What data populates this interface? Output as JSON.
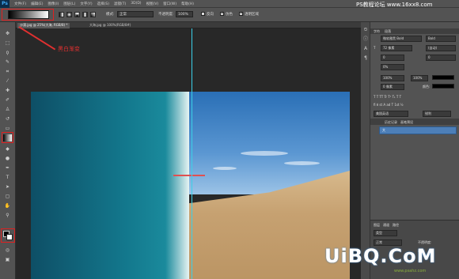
{
  "app": {
    "logo": "Ps"
  },
  "menu": [
    "文件(F)",
    "编辑(E)",
    "图像(I)",
    "图层(L)",
    "文字(Y)",
    "选择(S)",
    "滤镜(T)",
    "3D(D)",
    "视图(V)",
    "窗口(W)",
    "帮助(H)"
  ],
  "site_top": "PS教程论坛 www.16xx8.com",
  "options": {
    "mode_label": "模式:",
    "mode_value": "正常",
    "opacity_label": "不透明度:",
    "opacity_value": "100%",
    "reverse_label": "反向",
    "dither_label": "仿色",
    "transparency_label": "透明区域"
  },
  "tabs": [
    {
      "label": "沙漠.jpg @ 25%(大海, RGB/8) *"
    },
    {
      "label": "大海.jpg @ 100%(RGB/8#)"
    }
  ],
  "annotation": {
    "label": "黑白渐变"
  },
  "panel": {
    "tabs": [
      "字符",
      "段落"
    ],
    "font_family": "微软雅黑 Bold",
    "font_style": "Bold",
    "size": "72 像素",
    "leading": "(自动)",
    "tracking": "0",
    "kerning_value": "0%",
    "vscale": "100%",
    "hscale": "100%",
    "baseline": "0 像素",
    "color_label": "颜色:",
    "language": "美国英语",
    "antialias": "锐利",
    "layers_tabs": [
      "图层",
      "通道",
      "路径"
    ],
    "history_tabs": [
      "历史记录",
      "画笔预设"
    ],
    "layer_name": "大",
    "blend_mode": "正常",
    "layer_opacity_label": "不透明度:",
    "fill_label": "填充:",
    "kind": "类型"
  },
  "watermark": {
    "main": "UiBQ.CoM",
    "sub": "www.psahz.com"
  },
  "colors": {
    "accent": "#e02020",
    "guide": "#3ad0e8",
    "selection": "#4d7fb8"
  }
}
